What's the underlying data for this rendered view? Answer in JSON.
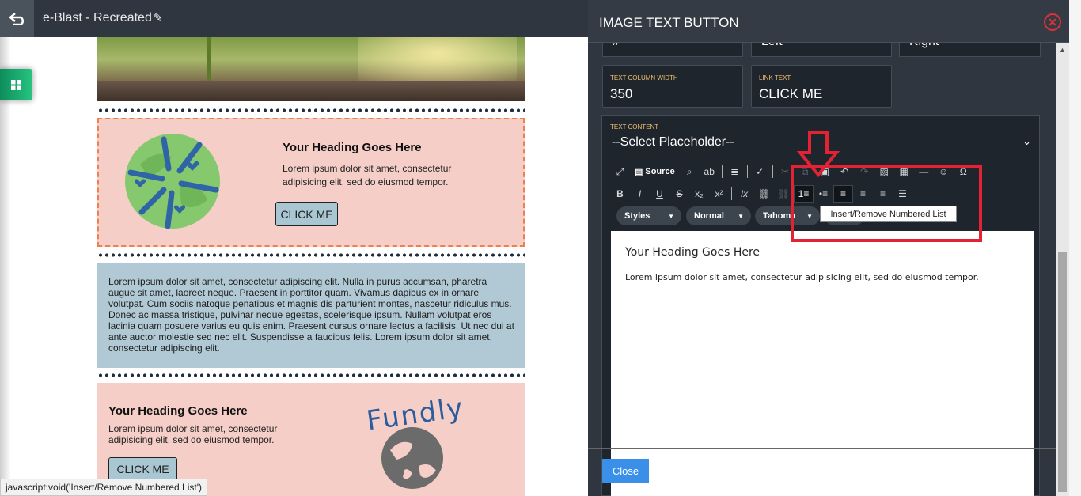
{
  "app": {
    "title": "e-Blast - Recreated"
  },
  "email": {
    "block1": {
      "heading": "Your Heading Goes Here",
      "text": "Lorem ipsum dolor sit amet, consectetur adipisicing elit, sed do eiusmod tempor.",
      "button": "CLICK ME"
    },
    "block2": {
      "text": "Lorem ipsum dolor sit amet, consectetur adipiscing elit. Nulla in purus accumsan, pharetra augue sit amet, laoreet neque. Praesent in porttitor quam. Vivamus dapibus ex in ornare volutpat. Cum sociis natoque penatibus et magnis dis parturient montes, nascetur ridiculus mus. Donec ac massa tristique, pulvinar neque egestas, scelerisque ipsum. Nullam volutpat eros lacinia quam posuere varius eu quis enim. Praesent cursus ornare lectus a facilisis. Ut nec dui at ante auctor molestie sed nec elit. Suspendisse a faucibus felis. Lorem ipsum dolor sit amet, consectetur adipiscing elit."
    },
    "block3": {
      "heading": "Your Heading Goes Here",
      "text": "Lorem ipsum dolor sit amet, consectetur adipisicing elit, sed do eiusmod tempor.",
      "button": "CLICK ME",
      "logo_text": "Fundly"
    }
  },
  "status_bar": "javascript:void('Insert/Remove Numbered List')",
  "panel": {
    "title": "IMAGE TEXT BUTTON",
    "cut_fields": [
      "#",
      "Left",
      "Right"
    ],
    "text_column_width": {
      "label": "TEXT COLUMN WIDTH",
      "value": "350"
    },
    "link_text": {
      "label": "LINK TEXT",
      "value": "CLICK ME"
    },
    "text_content": {
      "label": "TEXT CONTENT",
      "placeholder_select": "--Select Placeholder--"
    },
    "toolbar": {
      "source_label": "Source",
      "styles_combo": "Styles",
      "format_combo": "Normal",
      "font_combo": "Tahoma",
      "tooltip": "Insert/Remove Numbered List"
    },
    "editor": {
      "heading": "Your Heading Goes Here",
      "paragraph": "Lorem ipsum dolor sit amet, consectetur adipisicing elit, sed do eiusmod tempor."
    },
    "close_button": "Close"
  },
  "colors": {
    "panel_bg": "#2f3640",
    "accent_green": "#27c480",
    "annotation_red": "#e32233",
    "close_blue": "#3a8fe8",
    "block_pink": "#f5cfc7",
    "block_blue": "#b0c9d5"
  }
}
